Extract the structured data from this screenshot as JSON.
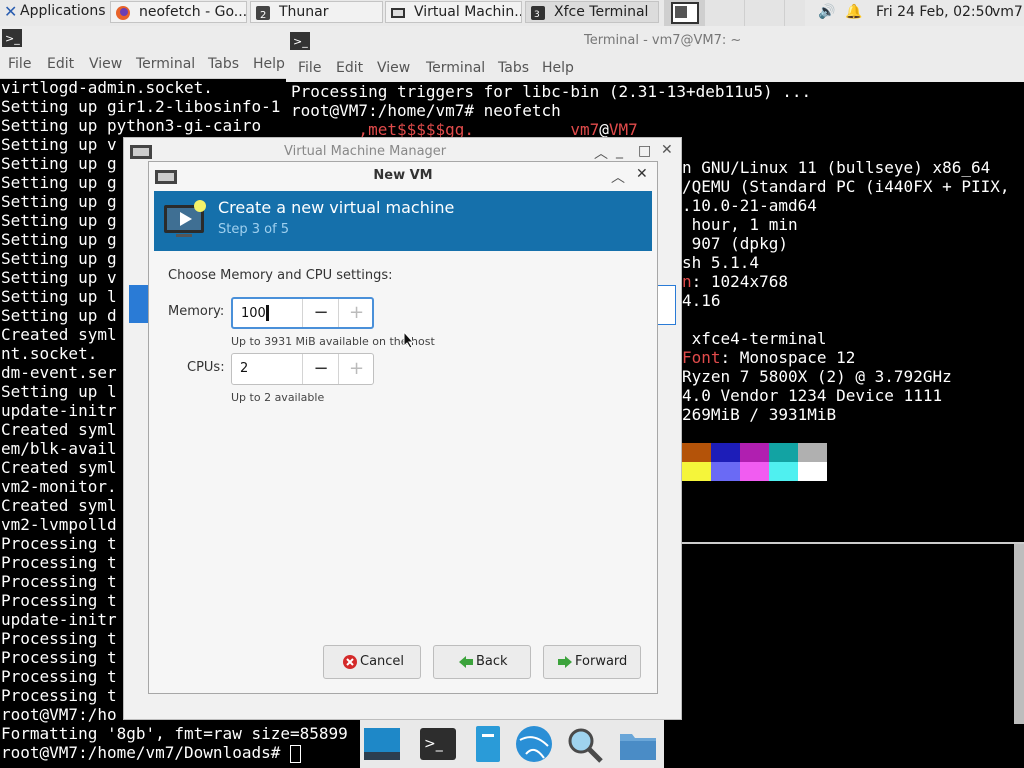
{
  "panel": {
    "apps_label": "Applications",
    "tasks": [
      {
        "label": "neofetch - Go..."
      },
      {
        "label": "Thunar"
      },
      {
        "label": "Virtual Machin..."
      },
      {
        "label": "Xfce Terminal"
      }
    ],
    "clock": "Fri 24 Feb, 02:50",
    "user": "vm7"
  },
  "term_left": {
    "menu": [
      "File",
      "Edit",
      "View",
      "Terminal",
      "Tabs",
      "Help"
    ],
    "lines": [
      "virtlogd-admin.socket.",
      "Setting up gir1.2-libosinfo-1",
      "Setting up python3-gi-cairo",
      "Setting up v",
      "Setting up g",
      "Setting up g",
      "Setting up g",
      "Setting up g",
      "Setting up g",
      "Setting up g",
      "Setting up v",
      "Setting up l",
      "Setting up d",
      "Created syml",
      "nt.socket.",
      "dm-event.ser",
      "Setting up l",
      "update-initr",
      "Created syml",
      "em/blk-avail",
      "Created syml",
      "vm2-monitor.",
      "Created syml",
      "vm2-lvmpolld",
      "Processing t",
      "Processing t",
      "Processing t",
      "Processing t",
      "update-initr",
      "Processing t",
      "Processing t",
      "Processing t",
      "Processing t",
      "root@VM7:/ho",
      "Formatting '8gb', fmt=raw size=85899",
      "root@VM7:/home/vm7/Downloads# "
    ]
  },
  "term_right": {
    "title": "Terminal - vm7@VM7: ~",
    "menu": [
      "File",
      "Edit",
      "View",
      "Terminal",
      "Tabs",
      "Help"
    ],
    "line1": "Processing triggers for libc-bin (2.31-13+deb11u5) ...",
    "line2": "root@VM7:/home/vm7# neofetch",
    "logo_line": "       ,met$$$$$gg.",
    "user_host_a": "vm7",
    "user_host_b": "@",
    "user_host_c": "VM7",
    "info": [
      {
        "key": "",
        "val": "n GNU/Linux 11 (bullseye) x86_64"
      },
      {
        "key": "",
        "val": "/QEMU (Standard PC (i440FX + PIIX,"
      },
      {
        "key": "",
        "val": ".10.0-21-amd64"
      },
      {
        "key": "",
        "val": " hour, 1 min"
      },
      {
        "key": "",
        "val": " 907 (dpkg)"
      },
      {
        "key": "",
        "val": "sh 5.1.4"
      },
      {
        "key": "n",
        "val": ": 1024x768"
      },
      {
        "key": "",
        "val": "4.16"
      },
      {
        "key": "",
        "val": ""
      },
      {
        "key": "",
        "val": " xfce4-terminal"
      },
      {
        "key": "Font",
        "val": ": Monospace 12"
      },
      {
        "key": "",
        "val": "Ryzen 7 5800X (2) @ 3.792GHz"
      },
      {
        "key": "",
        "val": "4.0 Vendor 1234 Device 1111"
      },
      {
        "key": "",
        "val": "269MiB / 3931MiB"
      }
    ],
    "palette_top": [
      "#b45309",
      "#1d1db8",
      "#b01fb0",
      "#12a3a3",
      "#b0b0b0"
    ],
    "palette_bottom": [
      "#f5f53a",
      "#6a6af5",
      "#f15cf1",
      "#4ff0f0",
      "#ffffff"
    ]
  },
  "vmm": {
    "title": "Virtual Machine Manager"
  },
  "dialog": {
    "title": "New VM",
    "banner_title": "Create a new virtual machine",
    "banner_step": "Step 3 of 5",
    "section": "Choose Memory and CPU settings:",
    "memory_label": "Memory:",
    "memory_value": "100",
    "memory_hint": "Up to 3931 MiB available on the host",
    "cpus_label": "CPUs:",
    "cpus_value": "2",
    "cpus_hint": "Up to 2 available",
    "minus": "−",
    "plus": "+",
    "cancel": "Cancel",
    "back": "Back",
    "forward": "Forward"
  },
  "colors": {
    "accent": "#1570ab",
    "focus": "#4a90d9"
  }
}
